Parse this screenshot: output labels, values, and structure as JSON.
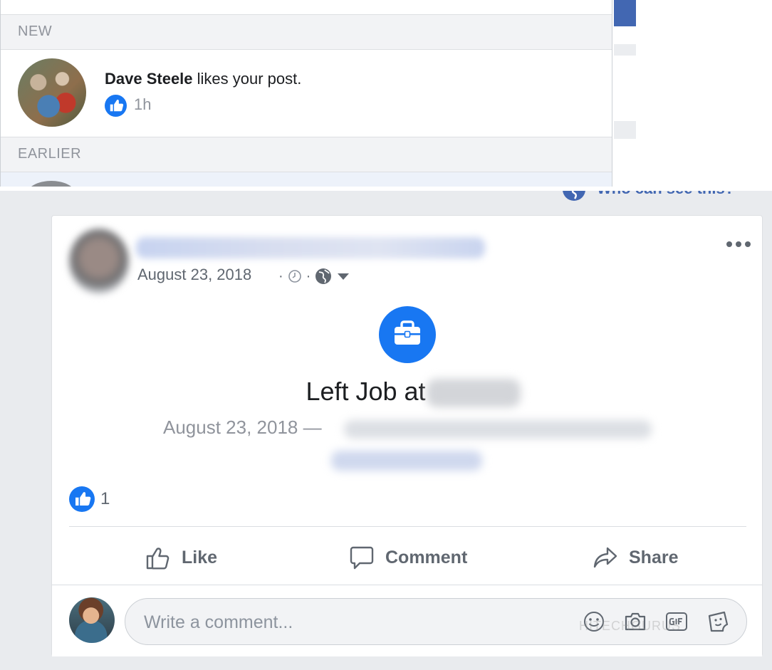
{
  "notifications": {
    "sections": {
      "new": "NEW",
      "earlier": "EARLIER"
    },
    "items": [
      {
        "actor": "Dave Steele",
        "action": " likes your post.",
        "time": "1h",
        "reaction_icon": "like-icon"
      }
    ]
  },
  "post": {
    "who_can_see": "Who can see this?",
    "date": "August 23, 2018",
    "meta_separator": "·",
    "privacy_icon": "globe-icon",
    "life_event": {
      "icon": "briefcase-icon",
      "title": "Left Job at",
      "subtitle_date": "August 23, 2018 —"
    },
    "reactions": {
      "count": "1",
      "icon": "like-icon"
    },
    "actions": {
      "like": "Like",
      "comment": "Comment",
      "share": "Share"
    },
    "comment": {
      "placeholder": "Write a comment...",
      "tools": [
        "emoji-icon",
        "camera-icon",
        "gif-icon",
        "sticker-icon"
      ]
    },
    "watermark": "HITECHGURUS"
  },
  "colors": {
    "accent": "#1877f2",
    "brand": "#4267b2",
    "secondary_text": "#606770",
    "background": "#e9ebee"
  }
}
